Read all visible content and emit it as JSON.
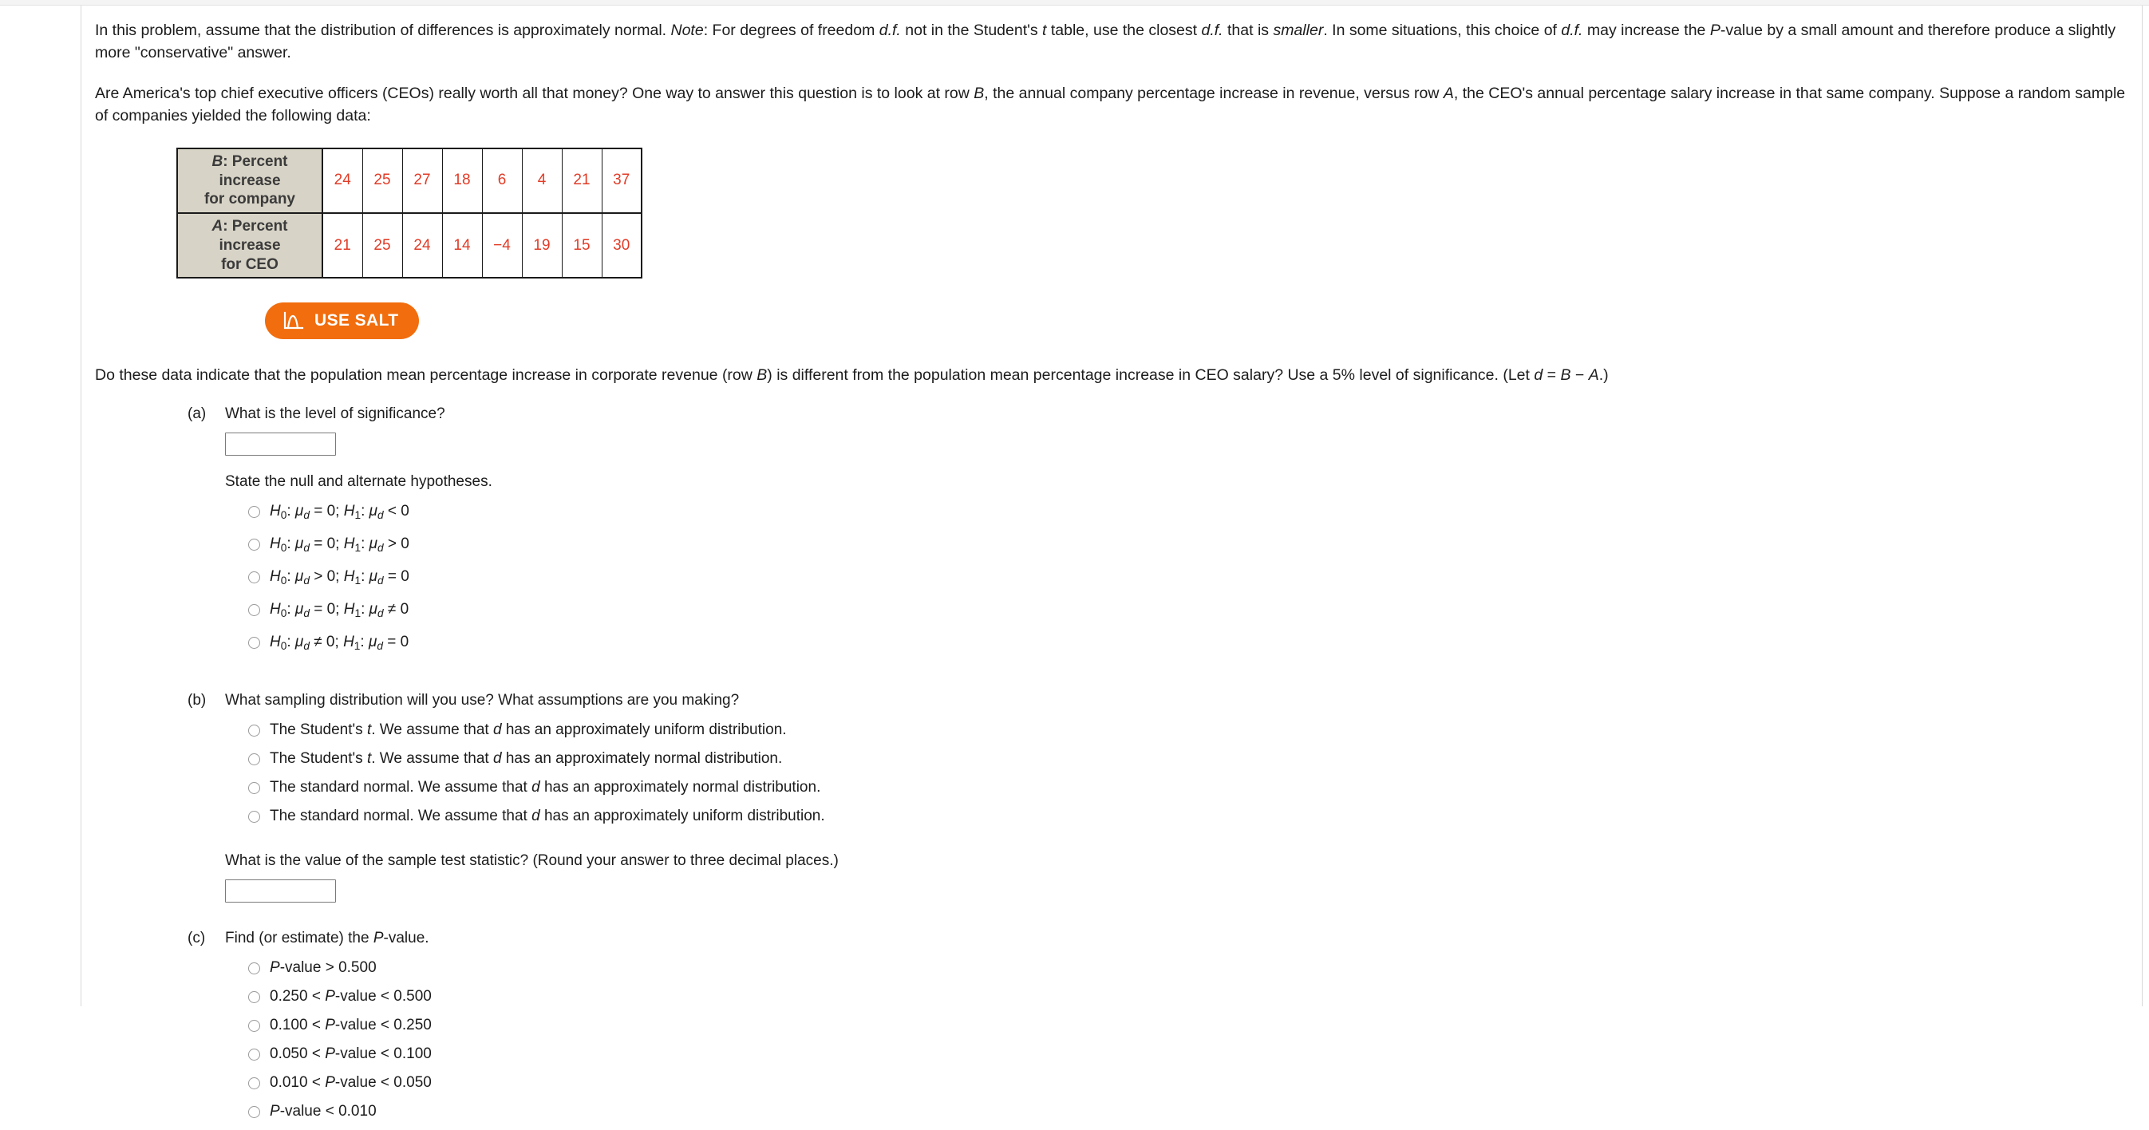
{
  "intro": {
    "paragraph1": "In this problem, assume that the distribution of differences is approximately normal. Note: For degrees of freedom d.f. not in the Student's t table, use the closest d.f. that is smaller. In some situations, this choice of d.f. may increase the P-value by a small amount and therefore produce a slightly more \"conservative\" answer.",
    "paragraph2": "Are America's top chief executive officers (CEOs) really worth all that money? One way to answer this question is to look at row B, the annual company percentage increase in revenue, versus row A, the CEO's annual percentage salary increase in that same company. Suppose a random sample of companies yielded the following data:"
  },
  "data_table": {
    "rows": [
      {
        "header_prefix": "B",
        "header_line1": ": Percent increase",
        "header_line2": "for company",
        "values": [
          "24",
          "25",
          "27",
          "18",
          "6",
          "4",
          "21",
          "37"
        ]
      },
      {
        "header_prefix": "A",
        "header_line1": ": Percent increase",
        "header_line2": "for CEO",
        "values": [
          "21",
          "25",
          "24",
          "14",
          "−4",
          "19",
          "15",
          "30"
        ]
      }
    ],
    "value_color": "#e23b26",
    "header_bg": "#d7d3c6"
  },
  "salt_button": {
    "label": "USE SALT",
    "icon": "normal-curve-icon",
    "color": "#f26d0d"
  },
  "main_question": "Do these data indicate that the population mean percentage increase in corporate revenue (row B) is different from the population mean percentage increase in CEO salary? Use a 5% level of significance. (Let d = B − A.)",
  "parts": [
    {
      "label": "(a)",
      "title": "What is the level of significance?",
      "input_value": "",
      "input_placeholder": "",
      "sub_text": "State the null and alternate hypotheses.",
      "options": [
        "H₀: μ_d = 0; H₁: μ_d < 0",
        "H₀: μ_d = 0; H₁: μ_d > 0",
        "H₀: μ_d > 0; H₁: μ_d = 0",
        "H₀: μ_d = 0; H₁: μ_d ≠ 0",
        "H₀: μ_d ≠ 0; H₁: μ_d = 0"
      ]
    },
    {
      "label": "(b)",
      "title": "What sampling distribution will you use? What assumptions are you making?",
      "options": [
        "The Student's t. We assume that d has an approximately uniform distribution.",
        "The Student's t. We assume that d has an approximately normal distribution.",
        "The standard normal. We assume that d has an approximately normal distribution.",
        "The standard normal. We assume that d has an approximately uniform distribution."
      ],
      "follow_up": "What is the value of the sample test statistic? (Round your answer to three decimal places.)",
      "input_value": "",
      "input_placeholder": ""
    },
    {
      "label": "(c)",
      "title": "Find (or estimate) the P-value.",
      "options": [
        "P-value > 0.500",
        "0.250 < P-value < 0.500",
        "0.100 < P-value < 0.250",
        "0.050 < P-value < 0.100",
        "0.010 < P-value < 0.050",
        "P-value < 0.010"
      ]
    }
  ]
}
